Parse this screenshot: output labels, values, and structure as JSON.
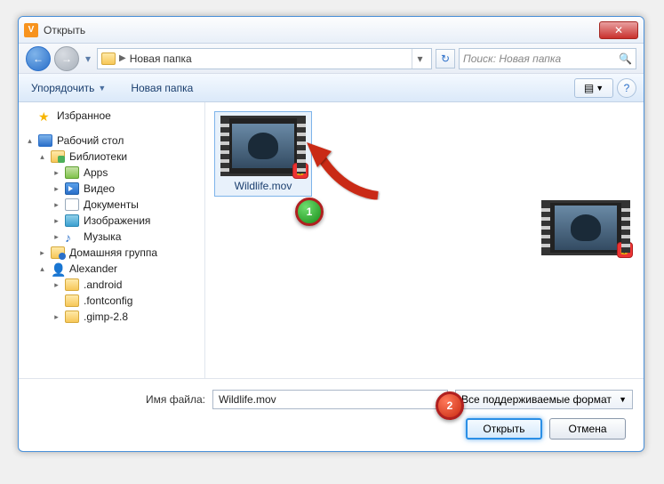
{
  "window": {
    "title": "Открыть"
  },
  "nav": {
    "path": "Новая папка",
    "search_placeholder": "Поиск: Новая папка"
  },
  "toolbar": {
    "organize": "Упорядочить",
    "newfolder": "Новая папка"
  },
  "tree": {
    "favorites": "Избранное",
    "desktop": "Рабочий стол",
    "libraries": "Библиотеки",
    "apps": "Apps",
    "video": "Видео",
    "documents": "Документы",
    "images": "Изображения",
    "music": "Музыка",
    "homegroup": "Домашняя группа",
    "user": "Alexander",
    "android": ".android",
    "fontconfig": ".fontconfig",
    "gimp": ".gimp-2.8"
  },
  "file": {
    "name": "Wildlife.mov"
  },
  "footer": {
    "filename_label": "Имя файла:",
    "filename_value": "Wildlife.mov",
    "filter": "Все поддерживаемые формат",
    "open": "Открыть",
    "cancel": "Отмена"
  },
  "annotations": {
    "step1": "1",
    "step2": "2"
  }
}
